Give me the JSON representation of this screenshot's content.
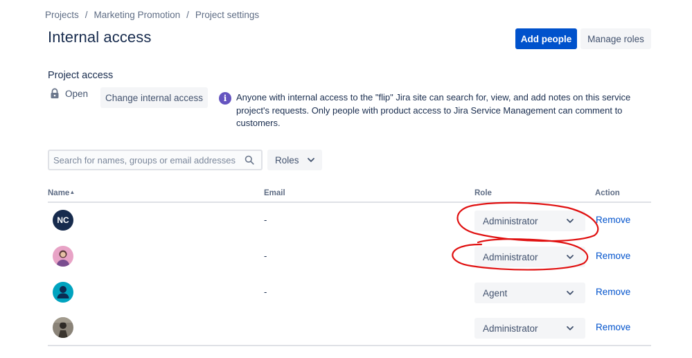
{
  "breadcrumb": {
    "items": [
      "Projects",
      "Marketing Promotion",
      "Project settings"
    ],
    "separator": "/"
  },
  "header": {
    "title": "Internal access",
    "add_people_label": "Add people",
    "manage_roles_label": "Manage roles"
  },
  "project_access": {
    "section_title": "Project access",
    "status_icon": "lock-icon",
    "status_label": "Open",
    "change_button_label": "Change internal access",
    "info_icon": "info-icon",
    "info_text": "Anyone with internal access to the \"flip\" Jira site can search for, view, and add notes on this service project's requests. Only people with product access to Jira Service Management can comment to customers."
  },
  "filters": {
    "search_placeholder": "Search for names, groups or email addresses",
    "roles_label": "Roles"
  },
  "table": {
    "columns": {
      "name": "Name",
      "email": "Email",
      "role": "Role",
      "action": "Action"
    },
    "rows": [
      {
        "avatar_initials": "NC",
        "avatar_type": "initials",
        "email": "-",
        "role": "Administrator",
        "action": "Remove"
      },
      {
        "avatar_initials": "",
        "avatar_type": "photo-pink",
        "email": "-",
        "role": "Administrator",
        "action": "Remove"
      },
      {
        "avatar_initials": "",
        "avatar_type": "default-user",
        "email": "-",
        "role": "Agent",
        "action": "Remove"
      },
      {
        "avatar_initials": "",
        "avatar_type": "photo-dark",
        "email": "",
        "role": "Administrator",
        "action": "Remove"
      }
    ]
  },
  "colors": {
    "primary": "#0052cc",
    "info": "#6554c0",
    "annotation": "#e01010"
  }
}
